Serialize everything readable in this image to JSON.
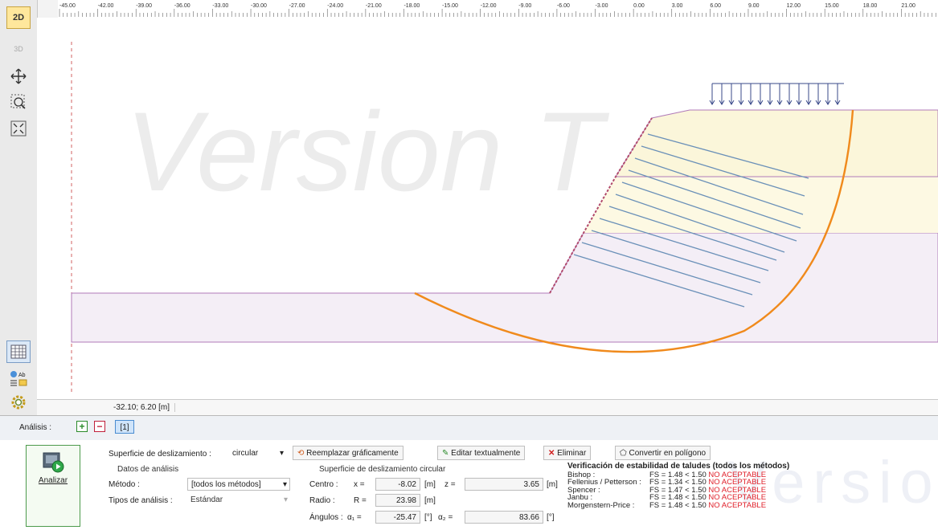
{
  "toolbar": {
    "mode_2d": "2D",
    "mode_3d": "3D",
    "icons": [
      "move-icon",
      "zoom-window-icon",
      "zoom-extents-icon",
      "table-icon",
      "legend-icon",
      "settings-icon"
    ]
  },
  "ruler": {
    "ticks": [
      "-45.00",
      "-42.00",
      "-39.00",
      "-36.00",
      "-33.00",
      "-30.00",
      "-27.00",
      "-24.00",
      "-21.00",
      "-18.00",
      "-15.00",
      "-12.00",
      "-9.00",
      "-6.00",
      "-3.00",
      "0.00",
      "3.00",
      "6.00",
      "9.00",
      "12.00",
      "15.00",
      "18.00",
      "21.00"
    ]
  },
  "watermark": {
    "main": "Version T",
    "panel": "Versio"
  },
  "status": {
    "coords": "-32.10; 6.20 [m]"
  },
  "stage_bar": {
    "label": "Análisis :",
    "add": "+",
    "remove": "−",
    "stage": "[1]"
  },
  "analyze": {
    "label": "Analizar"
  },
  "slip_surface": {
    "label": "Superficie de deslizamiento :",
    "type": "circular",
    "actions": {
      "replace": "Reemplazar gráficamente",
      "edit": "Editar textualmente",
      "delete": "Eliminar",
      "convert": "Convertir en polígono"
    }
  },
  "analysis_data": {
    "group": "Datos de análisis",
    "method_label": "Método :",
    "method_value": "[todos los métodos]",
    "types_label": "Tipos de análisis :",
    "types_value": "Estándar"
  },
  "circular": {
    "group": "Superficie de deslizamiento circular",
    "center_label": "Centro :",
    "x_label": "x =",
    "x_value": "-8.02",
    "x_unit": "[m]",
    "z_label": "z =",
    "z_value": "3.65",
    "z_unit": "[m]",
    "radius_label": "Radio :",
    "r_label": "R =",
    "r_value": "23.98",
    "r_unit": "[m]",
    "angles_label": "Ángulos :",
    "a1_label": "α₁ =",
    "a1_value": "-25.47",
    "a1_unit": "[°]",
    "a2_label": "α₂ =",
    "a2_value": "83.66",
    "a2_unit": "[°]"
  },
  "verification": {
    "title": "Verificación de estabilidad de taludes (todos los métodos)",
    "rows": [
      {
        "method": "Bishop :",
        "fs": "FS = 1.48 < 1.50",
        "status": "NO ACEPTABLE"
      },
      {
        "method": "Fellenius / Petterson :",
        "fs": "FS = 1.34 < 1.50",
        "status": "NO ACEPTABLE"
      },
      {
        "method": "Spencer :",
        "fs": "FS = 1.47 < 1.50",
        "status": "NO ACEPTABLE"
      },
      {
        "method": "Janbu :",
        "fs": "FS = 1.48 < 1.50",
        "status": "NO ACEPTABLE"
      },
      {
        "method": "Morgenstern-Price :",
        "fs": "FS = 1.48 < 1.50",
        "status": "NO ACEPTABLE"
      }
    ]
  },
  "colors": {
    "slip_circle": "#f08a1c",
    "layer_top": "#fdf9e3",
    "layer_bottom": "#f4eef6",
    "layer_border": "#b07ab8",
    "nail": "#6a90b8",
    "load": "#3a4a8a",
    "error": "#e0202a"
  }
}
